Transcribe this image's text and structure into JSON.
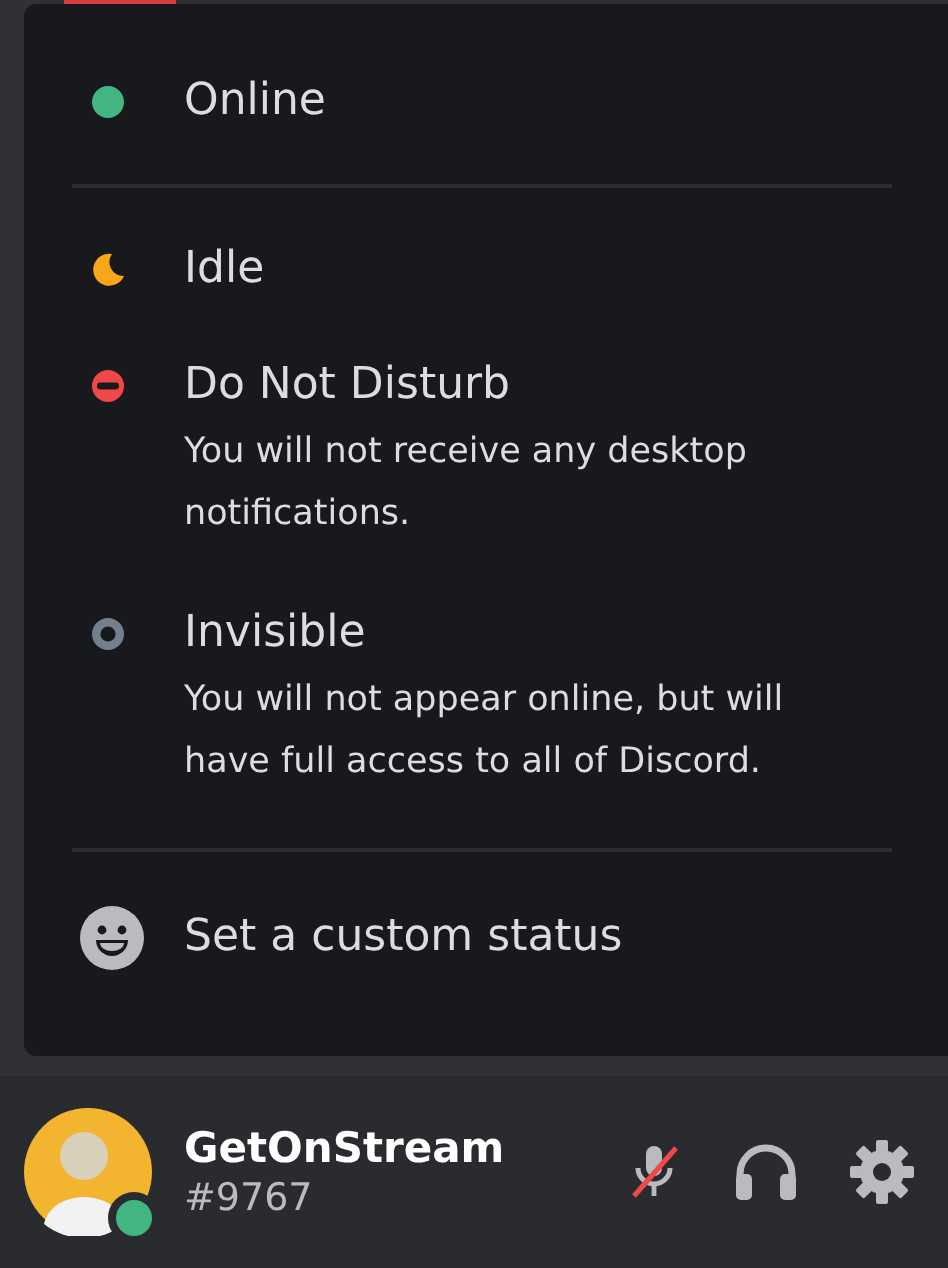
{
  "status_menu": {
    "items": [
      {
        "kind": "online",
        "label": "Online"
      },
      {
        "kind": "idle",
        "label": "Idle"
      },
      {
        "kind": "dnd",
        "label": "Do Not Disturb",
        "description": "You will not receive any desktop notifications."
      },
      {
        "kind": "invisible",
        "label": "Invisible",
        "description": "You will not appear online, but will have full access to all of Discord."
      }
    ],
    "custom_status": {
      "label": "Set a custom status"
    }
  },
  "user_panel": {
    "username": "GetOnStream",
    "tag": "#9767",
    "online": true,
    "mic_muted": true
  }
}
